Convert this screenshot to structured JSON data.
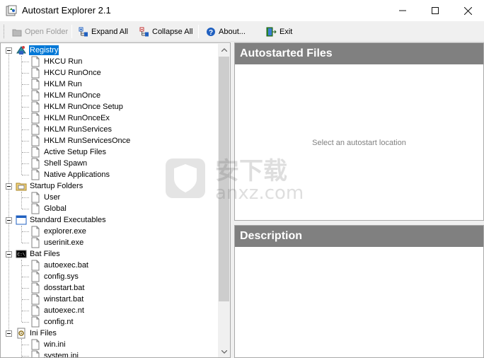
{
  "window": {
    "title": "Autostart Explorer 2.1",
    "controls": [
      "minimize",
      "maximize",
      "close"
    ]
  },
  "toolbar": {
    "open_folder": "Open Folder",
    "expand_all": "Expand All",
    "collapse_all": "Collapse All",
    "about": "About...",
    "exit": "Exit"
  },
  "tree": {
    "registry": {
      "label": "Registry",
      "children": [
        "HKCU Run",
        "HKCU RunOnce",
        "HKLM Run",
        "HKLM RunOnce",
        "HKLM RunOnce Setup",
        "HKLM RunOnceEx",
        "HKLM RunServices",
        "HKLM RunServicesOnce",
        "Active Setup Files",
        "Shell Spawn",
        "Native Applications"
      ]
    },
    "startup_folders": {
      "label": "Startup Folders",
      "children": [
        "User",
        "Global"
      ]
    },
    "standard_executables": {
      "label": "Standard Executables",
      "children": [
        "explorer.exe",
        "userinit.exe"
      ]
    },
    "bat_files": {
      "label": "Bat Files",
      "children": [
        "autoexec.bat",
        "config.sys",
        "dosstart.bat",
        "winstart.bat",
        "autoexec.nt",
        "config.nt"
      ]
    },
    "ini_files": {
      "label": "Ini Files",
      "children": [
        "win.ini",
        "system.ini"
      ]
    }
  },
  "autostarted_panel": {
    "title": "Autostarted Files",
    "placeholder": "Select an autostart location"
  },
  "description_panel": {
    "title": "Description"
  },
  "watermark": {
    "text_cn": "安下载",
    "text_url": "anxz.com"
  },
  "colors": {
    "selection": "#0078d7",
    "panel_header": "#808080",
    "disabled_text": "#9a9a9a"
  }
}
